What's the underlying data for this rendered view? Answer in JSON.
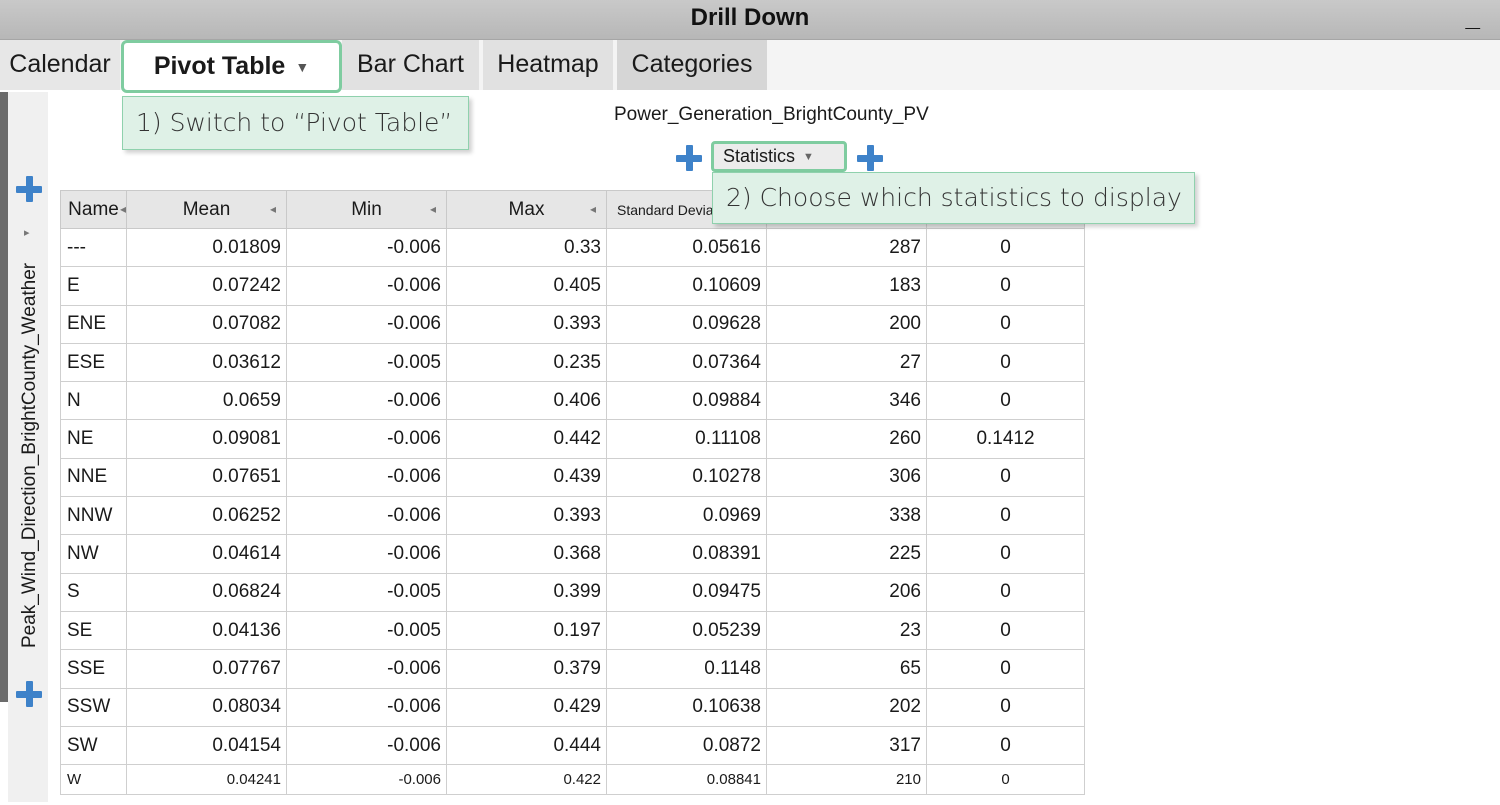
{
  "window": {
    "title": "Drill Down",
    "minimize_label": "_"
  },
  "tabs": [
    {
      "label": "Calendar"
    },
    {
      "label": "Pivot Table",
      "active": true
    },
    {
      "label": "Bar Chart"
    },
    {
      "label": "Heatmap"
    },
    {
      "label": "Categories"
    }
  ],
  "annotations": {
    "step1": "1) Switch to “Pivot Table”",
    "step2": "2) Choose which statistics to display"
  },
  "pivot": {
    "column_axis": "Power_Generation_BrightCounty_PV",
    "statistics_label": "Statistics",
    "row_axis": "Peak_Wind_Direction_BrightCounty_Weather",
    "headers": [
      "Name",
      "Mean",
      "Min",
      "Max",
      "Standard Deviat",
      "",
      ""
    ],
    "rows": [
      [
        "---",
        "0.01809",
        "-0.006",
        "0.33",
        "0.05616",
        "287",
        "0"
      ],
      [
        "E",
        "0.07242",
        "-0.006",
        "0.405",
        "0.10609",
        "183",
        "0"
      ],
      [
        "ENE",
        "0.07082",
        "-0.006",
        "0.393",
        "0.09628",
        "200",
        "0"
      ],
      [
        "ESE",
        "0.03612",
        "-0.005",
        "0.235",
        "0.07364",
        "27",
        "0"
      ],
      [
        "N",
        "0.0659",
        "-0.006",
        "0.406",
        "0.09884",
        "346",
        "0"
      ],
      [
        "NE",
        "0.09081",
        "-0.006",
        "0.442",
        "0.11108",
        "260",
        "0.1412"
      ],
      [
        "NNE",
        "0.07651",
        "-0.006",
        "0.439",
        "0.10278",
        "306",
        "0"
      ],
      [
        "NNW",
        "0.06252",
        "-0.006",
        "0.393",
        "0.0969",
        "338",
        "0"
      ],
      [
        "NW",
        "0.04614",
        "-0.006",
        "0.368",
        "0.08391",
        "225",
        "0"
      ],
      [
        "S",
        "0.06824",
        "-0.005",
        "0.399",
        "0.09475",
        "206",
        "0"
      ],
      [
        "SE",
        "0.04136",
        "-0.005",
        "0.197",
        "0.05239",
        "23",
        "0"
      ],
      [
        "SSE",
        "0.07767",
        "-0.006",
        "0.379",
        "0.1148",
        "65",
        "0"
      ],
      [
        "SSW",
        "0.08034",
        "-0.006",
        "0.429",
        "0.10638",
        "202",
        "0"
      ],
      [
        "SW",
        "0.04154",
        "-0.006",
        "0.444",
        "0.0872",
        "317",
        "0"
      ],
      [
        "W",
        "0.04241",
        "-0.006",
        "0.422",
        "0.08841",
        "210",
        "0"
      ]
    ]
  },
  "colors": {
    "accent": "#7fcca0",
    "callout_bg": "#dff1e7",
    "plus": "#3e82c9",
    "titlebar": "#bfbfbf"
  }
}
